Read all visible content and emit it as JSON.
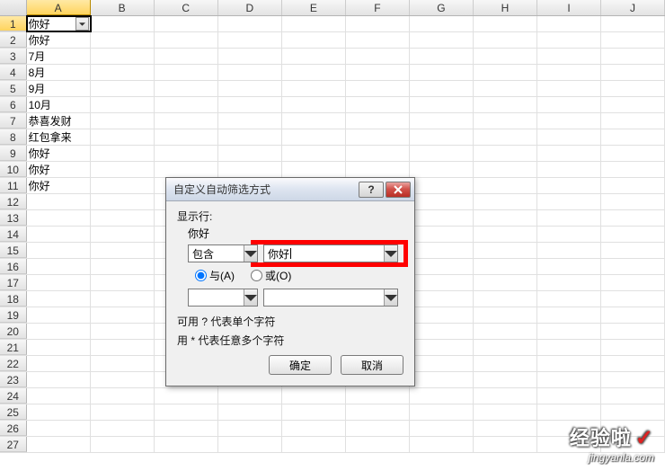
{
  "grid": {
    "columns": [
      "A",
      "B",
      "C",
      "D",
      "E",
      "F",
      "G",
      "H",
      "I",
      "J"
    ],
    "rows": [
      "1",
      "2",
      "3",
      "4",
      "5",
      "6",
      "7",
      "8",
      "9",
      "10",
      "11",
      "12",
      "13",
      "14",
      "15",
      "16",
      "17",
      "18",
      "19",
      "20",
      "21",
      "22",
      "23",
      "24",
      "25",
      "26",
      "27"
    ],
    "cells_colA": [
      "你好",
      "你好",
      "7月",
      "8月",
      "9月",
      "10月",
      "恭喜发财",
      "红包拿来",
      "你好",
      "你好",
      "你好",
      "",
      "",
      "",
      "",
      "",
      "",
      "",
      "",
      "",
      "",
      "",
      "",
      "",
      "",
      "",
      ""
    ]
  },
  "dialog": {
    "title": "自定义自动筛选方式",
    "show_rows_label": "显示行:",
    "column_label": "你好",
    "criteria1": {
      "op": "包含",
      "value": "你好"
    },
    "logic": {
      "and": "与(A)",
      "or": "或(O)",
      "selected": "and"
    },
    "criteria2": {
      "op": "",
      "value": ""
    },
    "help1": "可用 ? 代表单个字符",
    "help2": "用 * 代表任意多个字符",
    "ok": "确定",
    "cancel": "取消"
  },
  "watermark": {
    "brand": "经验啦",
    "url": "jingyanla.com"
  }
}
